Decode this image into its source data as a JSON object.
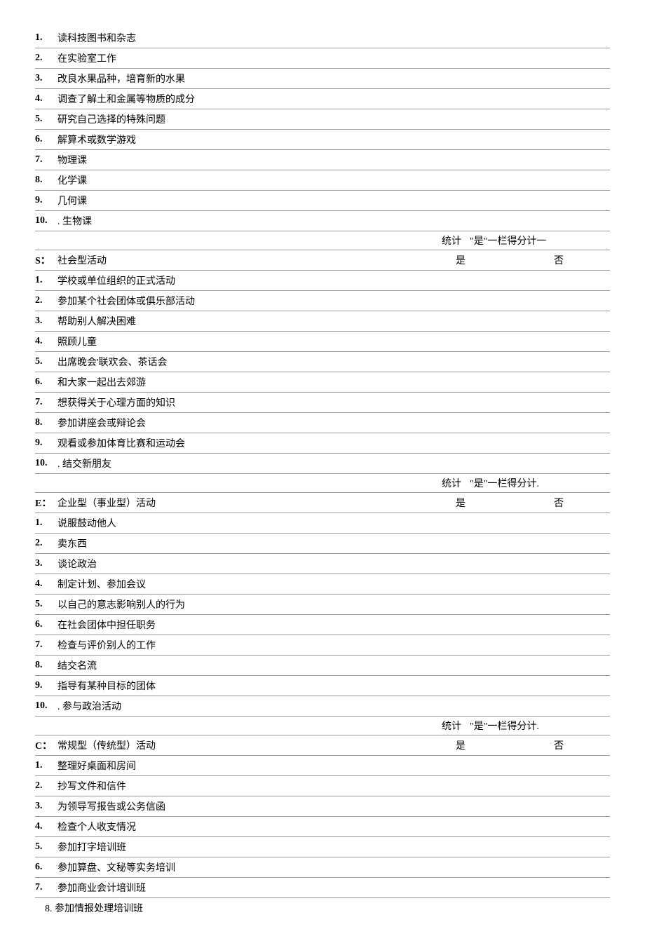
{
  "sections": [
    {
      "code": "",
      "title": "读科技图书和杂志",
      "items": [
        {
          "num": "2.",
          "text": "在实验室工作"
        },
        {
          "num": "3.",
          "text": "改良水果品种，培育新的水果"
        },
        {
          "num": "4.",
          "text": "调查了解土和金属等物质的成分"
        },
        {
          "num": "5.",
          "text": "研究自己选择的特殊问题"
        },
        {
          "num": "6.",
          "text": "解算术或数学游戏"
        },
        {
          "num": "7.",
          "text": "物理课"
        },
        {
          "num": "8.",
          "text": "化学课"
        },
        {
          "num": "9.",
          "text": "几何课"
        },
        {
          "num": "10.",
          "text": ". 生物课"
        }
      ],
      "first_num": "1.",
      "stat": "统计",
      "stat_text": "\"是\"一栏得分计一",
      "yes": "是",
      "no": "否",
      "sec_code": "S：",
      "sec_title": "社会型活动"
    },
    {
      "items": [
        {
          "num": "1.",
          "text": "学校或单位组织的正式活动"
        },
        {
          "num": "2.",
          "text": "参加某个社会团体或俱乐部活动"
        },
        {
          "num": "3.",
          "text": "帮助别人解决困难"
        },
        {
          "num": "4.",
          "text": "照顾儿童"
        },
        {
          "num": "5.",
          "text": "出席晚会'联欢会、茶话会"
        },
        {
          "num": "6.",
          "text": "和大家一起出去郊游"
        },
        {
          "num": "7.",
          "text": "想获得关于心理方面的知识"
        },
        {
          "num": "8.",
          "text": "参加讲座会或辩论会"
        },
        {
          "num": "9.",
          "text": "观看或参加体育比赛和运动会"
        },
        {
          "num": "10.",
          "text": ". 结交新朋友"
        }
      ],
      "stat": "统计",
      "stat_text": "\"是\"一栏得分计.",
      "yes": "是",
      "no": "否",
      "sec_code": "E：",
      "sec_title": "企业型（事业型）活动"
    },
    {
      "items": [
        {
          "num": "1.",
          "text": "说服鼓动他人"
        },
        {
          "num": "2.",
          "text": "卖东西"
        },
        {
          "num": "3.",
          "text": "谈论政治"
        },
        {
          "num": "4.",
          "text": "制定计划、参加会议"
        },
        {
          "num": "5.",
          "text": "以自己的意志影响别人的行为"
        },
        {
          "num": "6.",
          "text": "在社会团体中担任职务"
        },
        {
          "num": "7.",
          "text": "检查与评价别人的工作"
        },
        {
          "num": "8.",
          "text": "结交名流"
        },
        {
          "num": "9.",
          "text": "指导有某种目标的团体"
        },
        {
          "num": "10.",
          "text": ". 参与政治活动"
        }
      ],
      "stat": "统计",
      "stat_text": "\"是\"一栏得分计.",
      "yes": "是",
      "no": "否",
      "sec_code": "C：",
      "sec_title": "常规型（传统型）活动"
    },
    {
      "items": [
        {
          "num": "1.",
          "text": "整理好桌面和房间"
        },
        {
          "num": "2.",
          "text": "抄写文件和信件"
        },
        {
          "num": "3.",
          "text": "为领导写报告或公务信函"
        },
        {
          "num": "4.",
          "text": "检查个人收支情况"
        },
        {
          "num": "5.",
          "text": "参加打字培训班"
        },
        {
          "num": "6.",
          "text": "参加算盘、文秘等实务培训"
        },
        {
          "num": "7.",
          "text": "参加商业会计培训班"
        }
      ],
      "last_item": "8. 参加情报处理培训班"
    }
  ]
}
